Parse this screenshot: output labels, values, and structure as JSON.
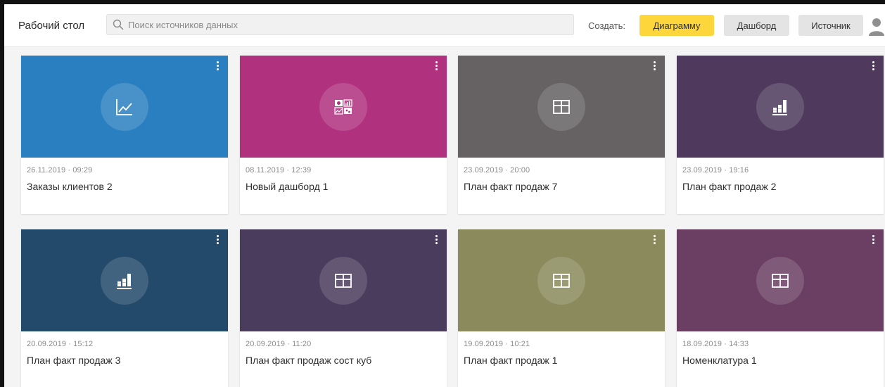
{
  "header": {
    "app_title": "Рабочий стол",
    "search_placeholder": "Поиск источников данных",
    "search_value": "",
    "create_label": "Создать:",
    "btn_chart": "Диаграмму",
    "btn_dashboard": "Дашборд",
    "btn_source": "Источник"
  },
  "colors": {
    "accent_button": "#fcd63a",
    "secondary_button": "#e4e4e4"
  },
  "cards": [
    {
      "date": "26.11.2019 · 09:29",
      "title": "Заказы клиентов 2",
      "color": "#2a7fc0",
      "icon": "line-chart-icon"
    },
    {
      "date": "08.11.2019 · 12:39",
      "title": "Новый дашборд 1",
      "color": "#b0327f",
      "icon": "dashboard-icon"
    },
    {
      "date": "23.09.2019 · 20:00",
      "title": "План факт продаж 7",
      "color": "#666264",
      "icon": "table-icon"
    },
    {
      "date": "23.09.2019 · 19:16",
      "title": "План факт продаж 2",
      "color": "#4f3a5e",
      "icon": "bar-chart-icon"
    },
    {
      "date": "20.09.2019 · 15:12",
      "title": "План факт продаж 3",
      "color": "#244a6b",
      "icon": "bar-chart-icon"
    },
    {
      "date": "20.09.2019 · 11:20",
      "title": "План факт продаж сост куб",
      "color": "#4a3c5c",
      "icon": "table-icon"
    },
    {
      "date": "19.09.2019 · 10:21",
      "title": "План факт продаж 1",
      "color": "#8a8a5c",
      "icon": "table-icon"
    },
    {
      "date": "18.09.2019 · 14:33",
      "title": "Номенклатура 1",
      "color": "#6a3f63",
      "icon": "table-icon"
    }
  ]
}
